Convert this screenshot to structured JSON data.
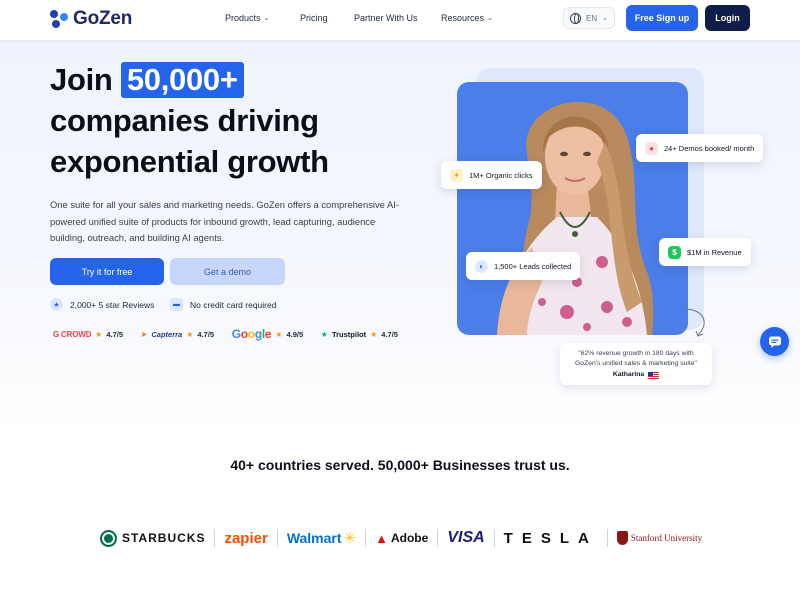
{
  "nav": {
    "brand": "GoZen",
    "links": [
      {
        "label": "Products",
        "has_dropdown": true
      },
      {
        "label": "Pricing",
        "has_dropdown": false
      },
      {
        "label": "Partner With Us",
        "has_dropdown": false
      },
      {
        "label": "Resources",
        "has_dropdown": true
      }
    ],
    "language": "EN",
    "signup_label": "Free Sign up",
    "login_label": "Login"
  },
  "hero": {
    "headline_highlight": "50,000+",
    "headline_prefix": "Join",
    "headline_line2": "companies driving",
    "headline_line3": "exponential growth",
    "subtext": "One suite for all your sales and marketing needs. GoZen offers a comprehensive AI-powered unified suite of products for inbound growth, lead capturing, audience building, outreach, and building AI agents.",
    "cta_primary": "Try it for free",
    "cta_secondary": "Get a demo",
    "features": [
      "2,000+ 5 star Reviews",
      "No credit card required"
    ],
    "ratings": [
      {
        "brand": "G CROWD",
        "score": "4.7/5"
      },
      {
        "brand": "Capterra",
        "score": "4.7/5"
      },
      {
        "brand": "Google",
        "score": "4.9/5"
      },
      {
        "brand": "Trustpilot",
        "score": "4.7/5"
      }
    ]
  },
  "stats_chips": {
    "demos": "24+ Demos booked/ month",
    "organic": "1M+ Organic clicks",
    "leads": "1,500+ Leads collected",
    "revenue": "$1M in Revenue"
  },
  "testimonial": {
    "quote": "\"62% revenue growth in 180 days with GoZen's unified sales & marketing suite\"",
    "author": "Katharina"
  },
  "trust": {
    "heading": "40+ countries served. 50,000+ Businesses trust us.",
    "logos": [
      "STARBUCKS",
      "zapier",
      "Walmart",
      "Adobe",
      "VISA",
      "TESLA",
      "Stanford University"
    ]
  },
  "colors": {
    "primary": "#2563eb",
    "navy": "#0f1d4a",
    "secondary_button": "#c7d7fb",
    "photo_background": "#4b7ee9"
  }
}
